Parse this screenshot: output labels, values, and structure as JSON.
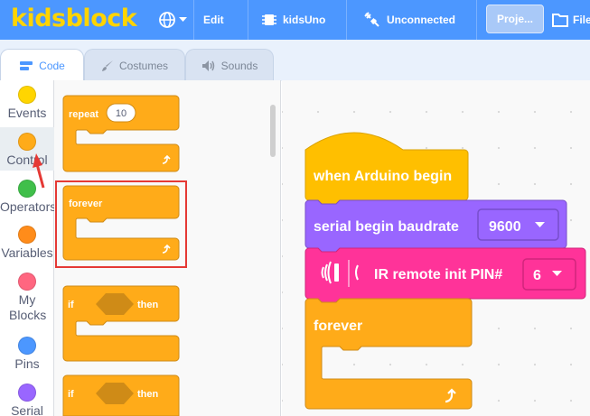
{
  "app": {
    "logo": "kidsblock"
  },
  "menubar": {
    "language_icon": "globe-icon",
    "edit_label": "Edit",
    "board_label": "kidsUno",
    "connection_label": "Unconnected",
    "project_label": "Proje...",
    "file_label": "File"
  },
  "tabs": [
    {
      "label": "Code",
      "icon": "code-icon",
      "active": true
    },
    {
      "label": "Costumes",
      "icon": "brush-icon",
      "active": false
    },
    {
      "label": "Sounds",
      "icon": "speaker-icon",
      "active": false
    }
  ],
  "categories": [
    {
      "label": "Events",
      "color": "#ffd500"
    },
    {
      "label": "Control",
      "color": "#ffab19"
    },
    {
      "label": "Operators",
      "color": "#40bf4a"
    },
    {
      "label": "Variables",
      "color": "#ff8c1a"
    },
    {
      "label": "My Blocks",
      "color": "#ff6680"
    },
    {
      "label": "Pins",
      "color": "#4c97ff"
    },
    {
      "label": "Serial",
      "color": "#9966ff"
    }
  ],
  "flyout": {
    "repeat_label": "repeat",
    "repeat_count": "10",
    "forever_label": "forever",
    "if_label": "if",
    "then_label": "then"
  },
  "script": {
    "hat_label": "when Arduino begin",
    "serial_label": "serial begin baudrate",
    "serial_value": "9600",
    "ir_label": "IR remote init PIN#",
    "ir_value": "6",
    "forever_label": "forever"
  },
  "colors": {
    "menubar": "#4c97ff",
    "control": "#ffab19",
    "events": "#ffbf00",
    "serial": "#9966ff",
    "ir_remote": "#ff3399",
    "highlight": "#e53935"
  }
}
